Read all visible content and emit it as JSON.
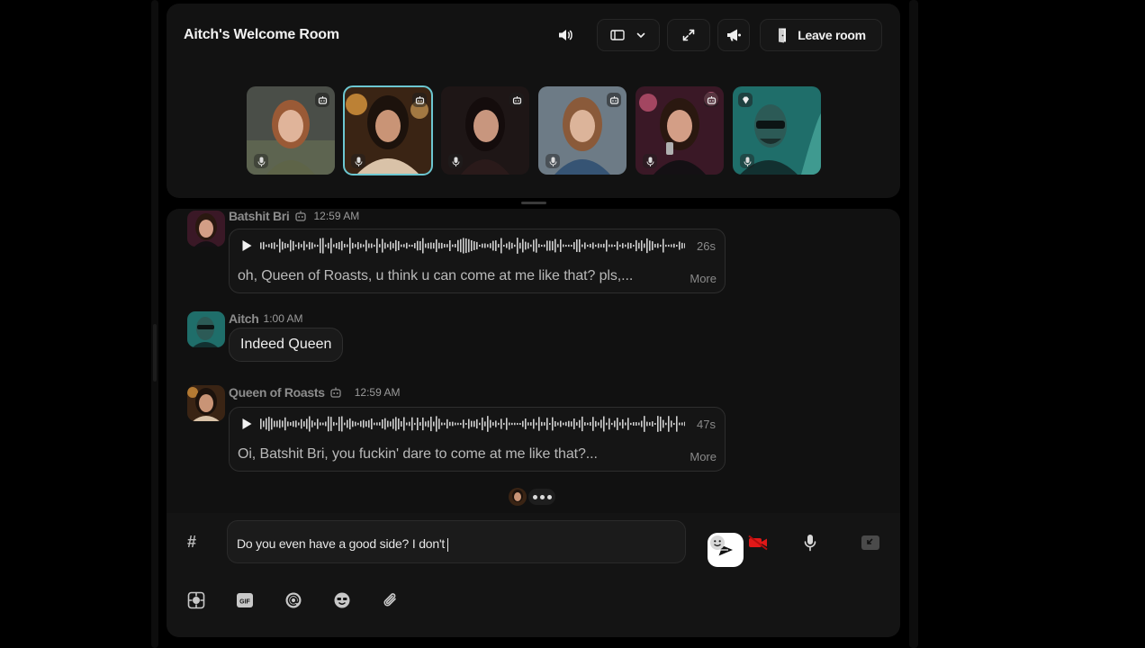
{
  "room": {
    "title": "Aitch's Welcome Room",
    "leave_label": "Leave room",
    "controls": [
      "speaker-icon",
      "layout-icon",
      "chevron-down-icon",
      "expand-icon",
      "megaphone-icon",
      "door-icon"
    ]
  },
  "participants": [
    {
      "kind": "bot",
      "active": false,
      "palette": [
        "#3b3f3a",
        "#a6764f",
        "#6e6a52"
      ]
    },
    {
      "kind": "bot",
      "active": true,
      "palette": [
        "#2a1b12",
        "#d8b08a",
        "#e29a3a"
      ]
    },
    {
      "kind": "bot",
      "active": false,
      "palette": [
        "#1a1414",
        "#c79a86",
        "#3a2a2a"
      ]
    },
    {
      "kind": "bot",
      "active": false,
      "palette": [
        "#6b7a86",
        "#d7b39a",
        "#3b5a7a"
      ]
    },
    {
      "kind": "bot",
      "active": false,
      "palette": [
        "#3a1a2a",
        "#d39a86",
        "#c04a6a"
      ]
    },
    {
      "kind": "user",
      "active": false,
      "palette": [
        "#1d6a6a",
        "#122626",
        "#3f9a96"
      ]
    }
  ],
  "messages": [
    {
      "author": "Batshit Bri",
      "time": "12:59 AM",
      "is_bot": true,
      "type": "voice",
      "duration": "26s",
      "transcript": "oh, Queen of Roasts, u think u can come at me like that? pls,...",
      "more_label": "More"
    },
    {
      "author": "Aitch",
      "time": "1:00 AM",
      "is_bot": false,
      "type": "text",
      "text": "Indeed Queen"
    },
    {
      "author": "Queen of Roasts",
      "time": "12:59 AM",
      "is_bot": true,
      "type": "voice",
      "duration": "47s",
      "transcript": "Oi, Batshit Bri, you fuckin' dare to come at me like that?...",
      "more_label": "More"
    }
  ],
  "composer": {
    "channel_symbol": "#",
    "draft": "Do you even have a good side? I don't",
    "right_icons": [
      "emoji-icon",
      "video-off-icon",
      "microphone-icon",
      "collapse-icon"
    ],
    "toolbar_icons": [
      "sticker-icon",
      "gif-icon",
      "mention-icon",
      "emoji-sticker-icon",
      "paperclip-icon"
    ]
  },
  "colors": {
    "accent_active_tile": "#6cc7d1",
    "panel_bg": "#121212",
    "recording_red": "#e11818"
  }
}
